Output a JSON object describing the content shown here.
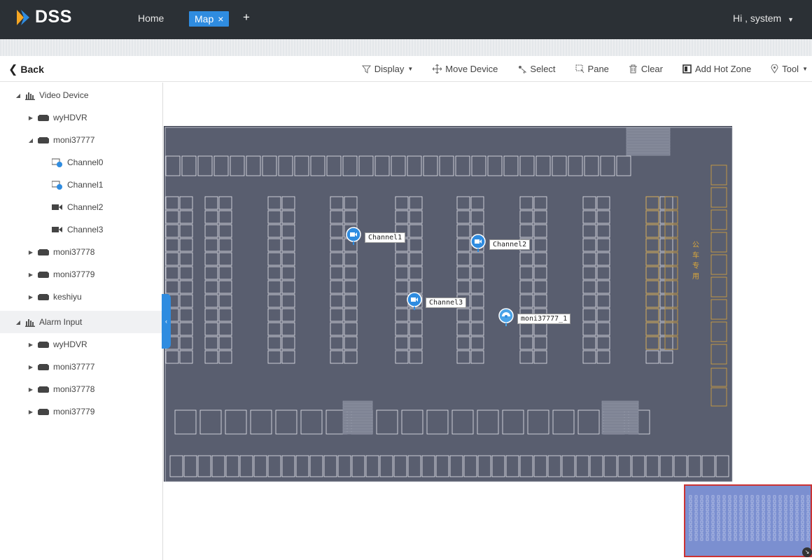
{
  "header": {
    "brand": "DSS",
    "nav_home": "Home",
    "active_tab": "Map",
    "tab_close": "×",
    "add_tab": "+",
    "user_greeting": "Hi , system"
  },
  "toolbar": {
    "back_label": "Back",
    "tools": {
      "display": "Display",
      "move_device": "Move Device",
      "select": "Select",
      "pane": "Pane",
      "clear": "Clear",
      "add_hot_zone": "Add Hot Zone",
      "tool": "Tool"
    }
  },
  "tree": {
    "video_device": "Video Device",
    "video_nodes": [
      "wyHDVR",
      "moni37777",
      "moni37778",
      "moni37779",
      "keshiyu"
    ],
    "channels": [
      "Channel0",
      "Channel1",
      "Channel2",
      "Channel3"
    ],
    "alarm_input": "Alarm Input",
    "alarm_nodes": [
      "wyHDVR",
      "moni37777",
      "moni37778",
      "moni37779"
    ]
  },
  "map": {
    "markers": {
      "channel1": "Channel1",
      "channel2": "Channel2",
      "channel3": "Channel3",
      "device": "moni37777_1"
    },
    "reserved_label": "公 车 专 用"
  },
  "colors": {
    "header_bg": "#2b3035",
    "accent": "#2f8ce0",
    "map_bg": "#595e6f",
    "minimap_border": "#cc3333"
  }
}
